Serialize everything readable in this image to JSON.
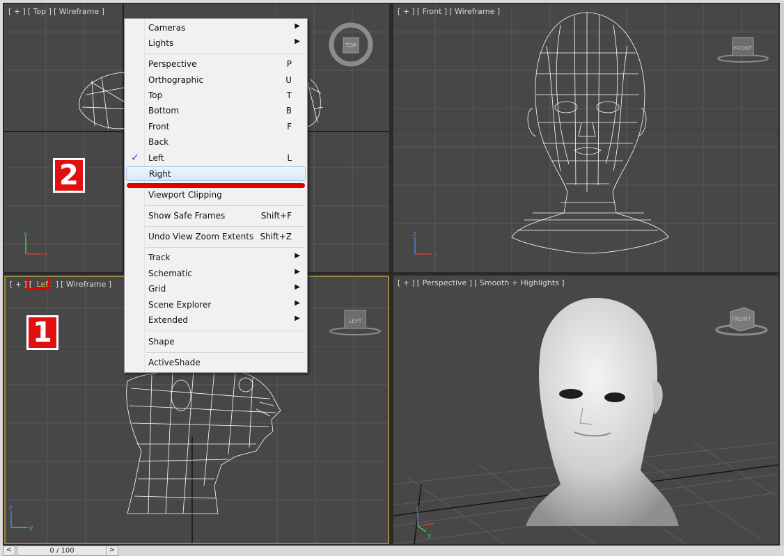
{
  "viewports": {
    "top": {
      "plus": "[ + ]",
      "view": "[ Top ]",
      "shading": "[ Wireframe ]",
      "cube": "TOP"
    },
    "front": {
      "plus": "[ + ]",
      "view": "[ Front ]",
      "shading": "[ Wireframe ]",
      "cube": "FRONT"
    },
    "left": {
      "plus": "[ + ]",
      "view": "Left",
      "shading": "[ Wireframe ]",
      "cube": "LEFT"
    },
    "perspective": {
      "plus": "[ + ]",
      "view": "[ Perspective ]",
      "shading": "[ Smooth + Highlights ]",
      "cube": "FRONT"
    }
  },
  "annotations": {
    "step1": "1",
    "step2": "2"
  },
  "menu": {
    "cameras": "Cameras",
    "lights": "Lights",
    "perspective": {
      "label": "Perspective",
      "shortcut": "P"
    },
    "orthographic": {
      "label": "Orthographic",
      "shortcut": "U"
    },
    "top": {
      "label": "Top",
      "shortcut": "T"
    },
    "bottom": {
      "label": "Bottom",
      "shortcut": "B"
    },
    "front": {
      "label": "Front",
      "shortcut": "F"
    },
    "back": {
      "label": "Back"
    },
    "left": {
      "label": "Left",
      "shortcut": "L",
      "checked": true
    },
    "right": {
      "label": "Right"
    },
    "viewport_clipping": "Viewport Clipping",
    "safe_frames": {
      "label": "Show Safe Frames",
      "shortcut": "Shift+F"
    },
    "undo_zoom": {
      "label": "Undo View Zoom Extents",
      "shortcut": "Shift+Z"
    },
    "track": "Track",
    "schematic": "Schematic",
    "grid": "Grid",
    "scene_explorer": "Scene Explorer",
    "extended": "Extended",
    "shape": "Shape",
    "activeshade": "ActiveShade",
    "check_glyph": "✓",
    "arrow_glyph": "▶"
  },
  "timeslider": {
    "prev": "<",
    "next": ">",
    "frame": "0 / 100",
    "progress": 0
  },
  "axes": {
    "x": "x",
    "y": "y",
    "z": "z"
  },
  "colors": {
    "viewport_bg": "#474747",
    "grid": "#5a5a5a",
    "active_border": "#9a8644",
    "highlight_red": "#e00000"
  }
}
